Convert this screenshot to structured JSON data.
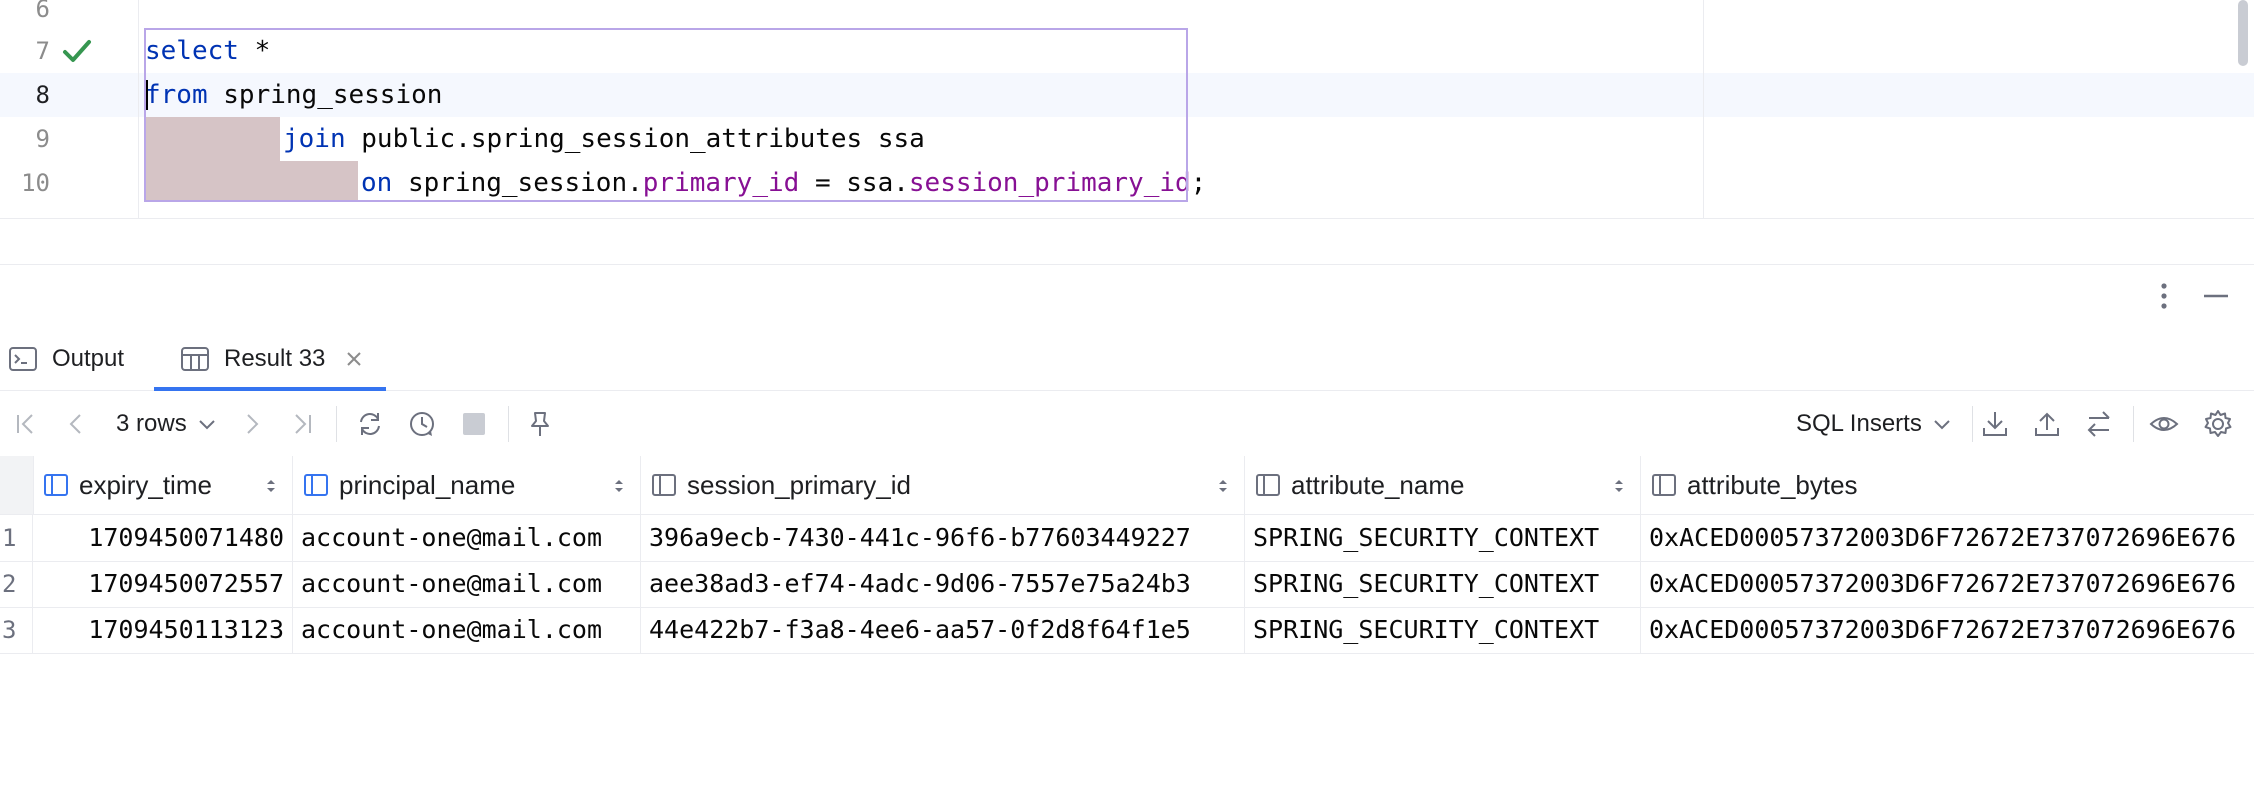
{
  "editor": {
    "lines": [
      {
        "number": "6",
        "status": ""
      },
      {
        "number": "7",
        "status": "check"
      },
      {
        "number": "8",
        "status": ""
      },
      {
        "number": "9",
        "status": ""
      },
      {
        "number": "10",
        "status": ""
      }
    ],
    "code": {
      "line7": {
        "kw": "select",
        "rest": " *"
      },
      "line8": {
        "kw": "from",
        "rest": " spring_session"
      },
      "line9": {
        "kw": "join",
        "rest": " public.spring_session_attributes ssa"
      },
      "line10": {
        "kw": "on",
        "t1": " spring_session.",
        "f1": "primary_id",
        "t2": " = ssa.",
        "f2": "session_primary_id",
        "t3": ";"
      }
    }
  },
  "tabs": [
    {
      "label": "Output",
      "icon": "console-icon",
      "active": false
    },
    {
      "label": "Result 33",
      "icon": "table-icon",
      "active": true,
      "closable": true
    }
  ],
  "toolbar": {
    "rows_label": "3 rows",
    "format_label": "SQL Inserts"
  },
  "grid": {
    "columns": [
      "expiry_time",
      "principal_name",
      "session_primary_id",
      "attribute_name",
      "attribute_bytes"
    ],
    "rows": [
      {
        "n": "1",
        "cells": [
          "1709450071480",
          "account-one@mail.com",
          "396a9ecb-7430-441c-96f6-b77603449227",
          "SPRING_SECURITY_CONTEXT",
          "0xACED00057372003D6F72672E737072696E676"
        ]
      },
      {
        "n": "2",
        "cells": [
          "1709450072557",
          "account-one@mail.com",
          "aee38ad3-ef74-4adc-9d06-7557e75a24b3",
          "SPRING_SECURITY_CONTEXT",
          "0xACED00057372003D6F72672E737072696E676"
        ]
      },
      {
        "n": "3",
        "cells": [
          "1709450113123",
          "account-one@mail.com",
          "44e422b7-f3a8-4ee6-aa57-0f2d8f64f1e5",
          "SPRING_SECURITY_CONTEXT",
          "0xACED00057372003D6F72672E737072696E676"
        ]
      }
    ]
  },
  "colors": {
    "keyword": "#0033b3",
    "field": "#871094",
    "accent": "#3574f0",
    "success": "#369650"
  }
}
